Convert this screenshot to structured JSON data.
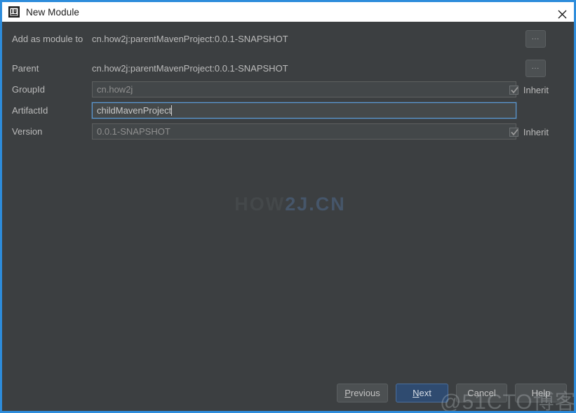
{
  "window": {
    "title": "New Module",
    "icon": "intellij-idea-icon",
    "close_icon": "close-icon",
    "accent_color": "#2d8cdb",
    "background_color": "#3c3f41",
    "titlebar_color": "#ffffff"
  },
  "form": {
    "rows": [
      {
        "label": "Add as module to",
        "type": "text",
        "value": "cn.how2j:parentMavenProject:0.0.1-SNAPSHOT",
        "browse_label": "..."
      },
      {
        "label": "Parent",
        "type": "text",
        "value": "cn.how2j:parentMavenProject:0.0.1-SNAPSHOT",
        "browse_label": "..."
      },
      {
        "label": "GroupId",
        "type": "input",
        "value": "cn.how2j",
        "state": "disabled",
        "inherit_label": "Inherit",
        "inherit_checked": true
      },
      {
        "label": "ArtifactId",
        "type": "input",
        "value": "childMavenProject",
        "state": "focused",
        "inherit_label": null,
        "inherit_checked": null
      },
      {
        "label": "Version",
        "type": "input",
        "value": "0.0.1-SNAPSHOT",
        "state": "disabled",
        "inherit_label": "Inherit",
        "inherit_checked": true
      }
    ]
  },
  "watermarks": {
    "center_part1": "HOW",
    "center_part2": "2J.CN",
    "center_color1": "#44484a",
    "center_color2": "#46566a",
    "bottom": "@51CTO博客"
  },
  "footer": {
    "previous": "Previous",
    "previous_mnemonic": "P",
    "previous_rest": "revious",
    "next": "Next",
    "next_mnemonic": "N",
    "next_rest": "ext",
    "cancel": "Cancel",
    "help": "Help",
    "default_button": "Next",
    "default_button_color": "#2f4b70"
  }
}
